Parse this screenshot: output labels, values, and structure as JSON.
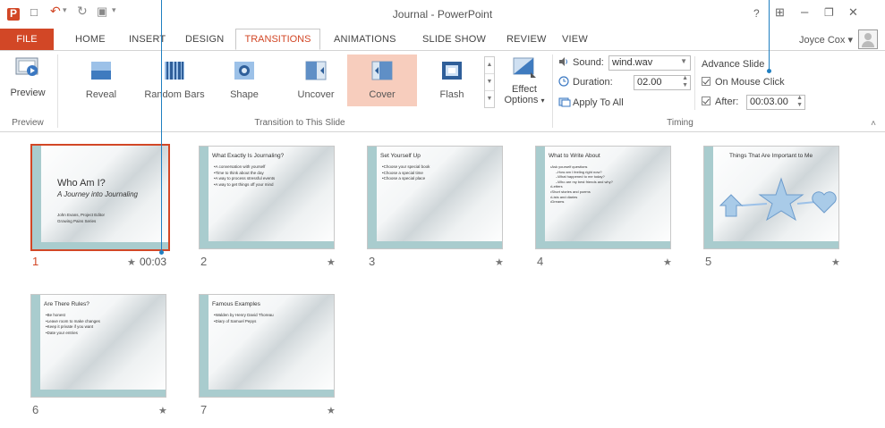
{
  "window": {
    "title": "Journal - PowerPoint",
    "help": "?",
    "options": "⊞",
    "minimize": "–",
    "restore": "❐",
    "close": "✕"
  },
  "qat": {
    "save": "💾",
    "undo": "↶",
    "undo_dd": "▾",
    "redo": "↻",
    "present": "▣",
    "more": "▾"
  },
  "tabs": {
    "file": "FILE",
    "home": "HOME",
    "insert": "INSERT",
    "design": "DESIGN",
    "transitions": "TRANSITIONS",
    "animations": "ANIMATIONS",
    "slideshow": "SLIDE SHOW",
    "review": "REVIEW",
    "view": "VIEW"
  },
  "user": {
    "name": "Joyce Cox",
    "dropdown": "▾"
  },
  "ribbon": {
    "preview_group": {
      "button": "Preview",
      "label": "Preview"
    },
    "transition_group": {
      "label": "Transition to This Slide",
      "items": [
        {
          "label": "Reveal",
          "icon": "reveal-icon"
        },
        {
          "label": "Random Bars",
          "icon": "random-bars-icon"
        },
        {
          "label": "Shape",
          "icon": "shape-icon"
        },
        {
          "label": "Uncover",
          "icon": "uncover-icon"
        },
        {
          "label": "Cover",
          "icon": "cover-icon",
          "selected": true
        },
        {
          "label": "Flash",
          "icon": "flash-icon"
        }
      ],
      "effect_options_1": "Effect",
      "effect_options_2": "Options",
      "effect_options_arrow": "▾"
    },
    "timing_group": {
      "label": "Timing",
      "sound_label": "Sound:",
      "sound_value": "wind.wav",
      "duration_label": "Duration:",
      "duration_value": "02.00",
      "apply_all": "Apply To All",
      "advance_label": "Advance Slide",
      "on_mouse_click": "On Mouse Click",
      "on_mouse_click_checked": true,
      "after_label": "After:",
      "after_checked": true,
      "after_value": "00:03.00"
    },
    "collapse": "˄"
  },
  "slides": [
    {
      "number": "1",
      "title": "Who Am I?",
      "subtitle": "A Journey into Journaling",
      "meta1": "John Evans, Project Editor",
      "meta2": "Growing Pains Series",
      "selected": true,
      "timing": "00:03",
      "star": "★"
    },
    {
      "number": "2",
      "title": "What Exactly Is Journaling?",
      "bullets": [
        "A conversation with yourself",
        "Time to think about the day",
        "A way to process stressful events",
        "A way to get things off your mind"
      ],
      "star": "★"
    },
    {
      "number": "3",
      "title": "Set Yourself Up",
      "bullets": [
        "Choose your special book",
        "Choose a special time",
        "Choose a special place"
      ],
      "star": "★"
    },
    {
      "number": "4",
      "title": "What to Write About",
      "bullets": [
        "Ask yourself questions",
        "How am I feeling right now?",
        "What happened to me today?",
        "Who are my best friends and why?",
        "Letters",
        "Short stories and poems",
        "Lists and diaries",
        "Dreams"
      ],
      "star": "★"
    },
    {
      "number": "5",
      "title": "Things That Are Important to Me",
      "star": "★"
    },
    {
      "number": "6",
      "title": "Are There Rules?",
      "bullets": [
        "Be honest",
        "Leave room to make changes",
        "Keep it private if you want",
        "Date your entries"
      ],
      "star": "★"
    },
    {
      "number": "7",
      "title": "Famous Examples",
      "bullets": [
        "Walden by Henry David Thoreau",
        "Diary of Samuel Pepys"
      ],
      "star": "★"
    }
  ],
  "colors": {
    "accent": "#d24726",
    "callout": "#1f7fc1",
    "slide_bar": "#a9ccce",
    "selected_fill": "#f7cdbd"
  }
}
